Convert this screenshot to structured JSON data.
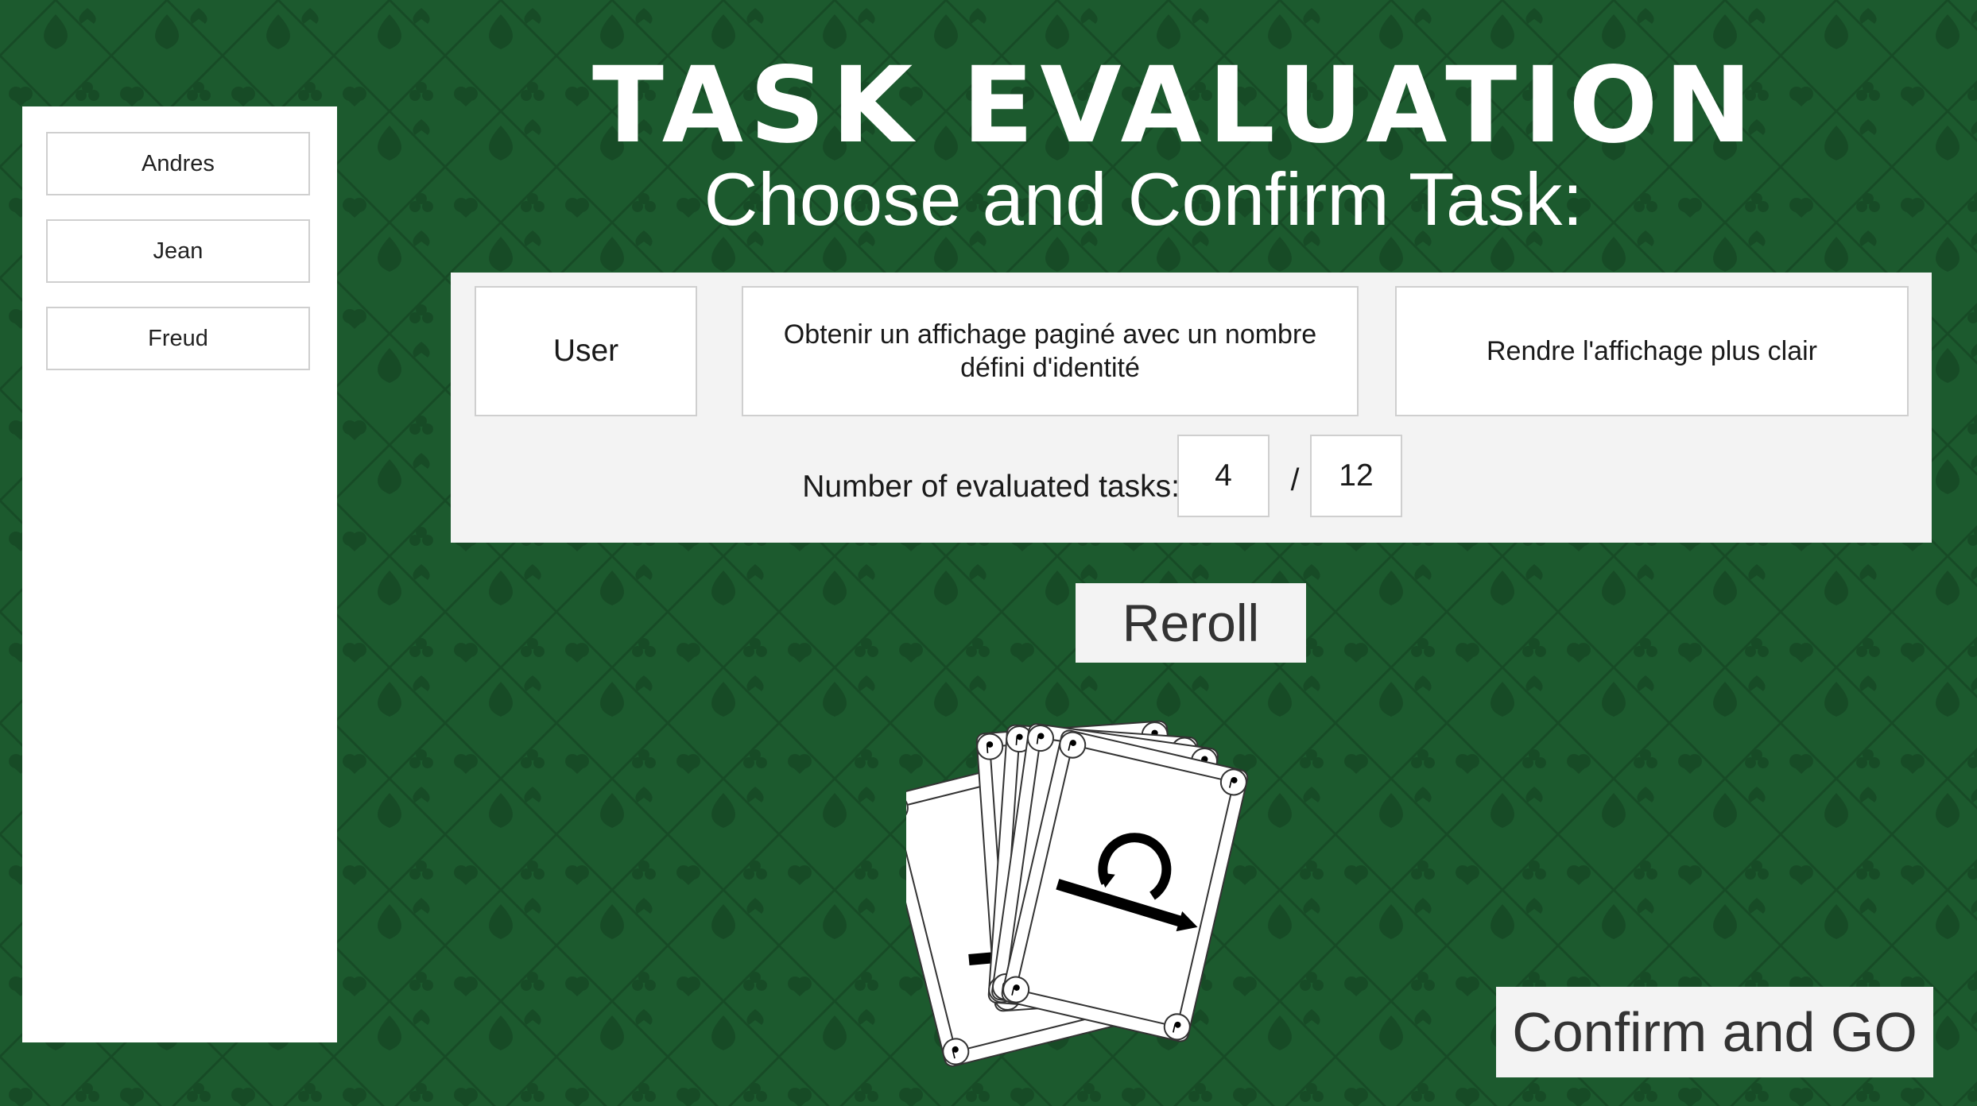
{
  "title": "TASK EVALUATION",
  "subtitle": "Choose and Confirm Task:",
  "sidebar": {
    "players": [
      {
        "label": "Andres"
      },
      {
        "label": "Jean"
      },
      {
        "label": "Freud"
      }
    ]
  },
  "task": {
    "role": "User",
    "goal": "Obtenir un affichage paginé avec un nombre défini d'identité",
    "benefit": "Rendre l'affichage plus clair"
  },
  "evaluation": {
    "label": "Number of evaluated tasks:",
    "evaluated": "4",
    "separator": "/",
    "total": "12"
  },
  "buttons": {
    "reroll": "Reroll",
    "confirm": "Confirm and GO"
  },
  "colors": {
    "table_green": "#1c5a2e",
    "pattern_green": "#174b26",
    "panel": "#f3f3f3"
  },
  "icons": {
    "background": "card-suit-pattern",
    "cards": "reverse-arrow-card-icon"
  }
}
